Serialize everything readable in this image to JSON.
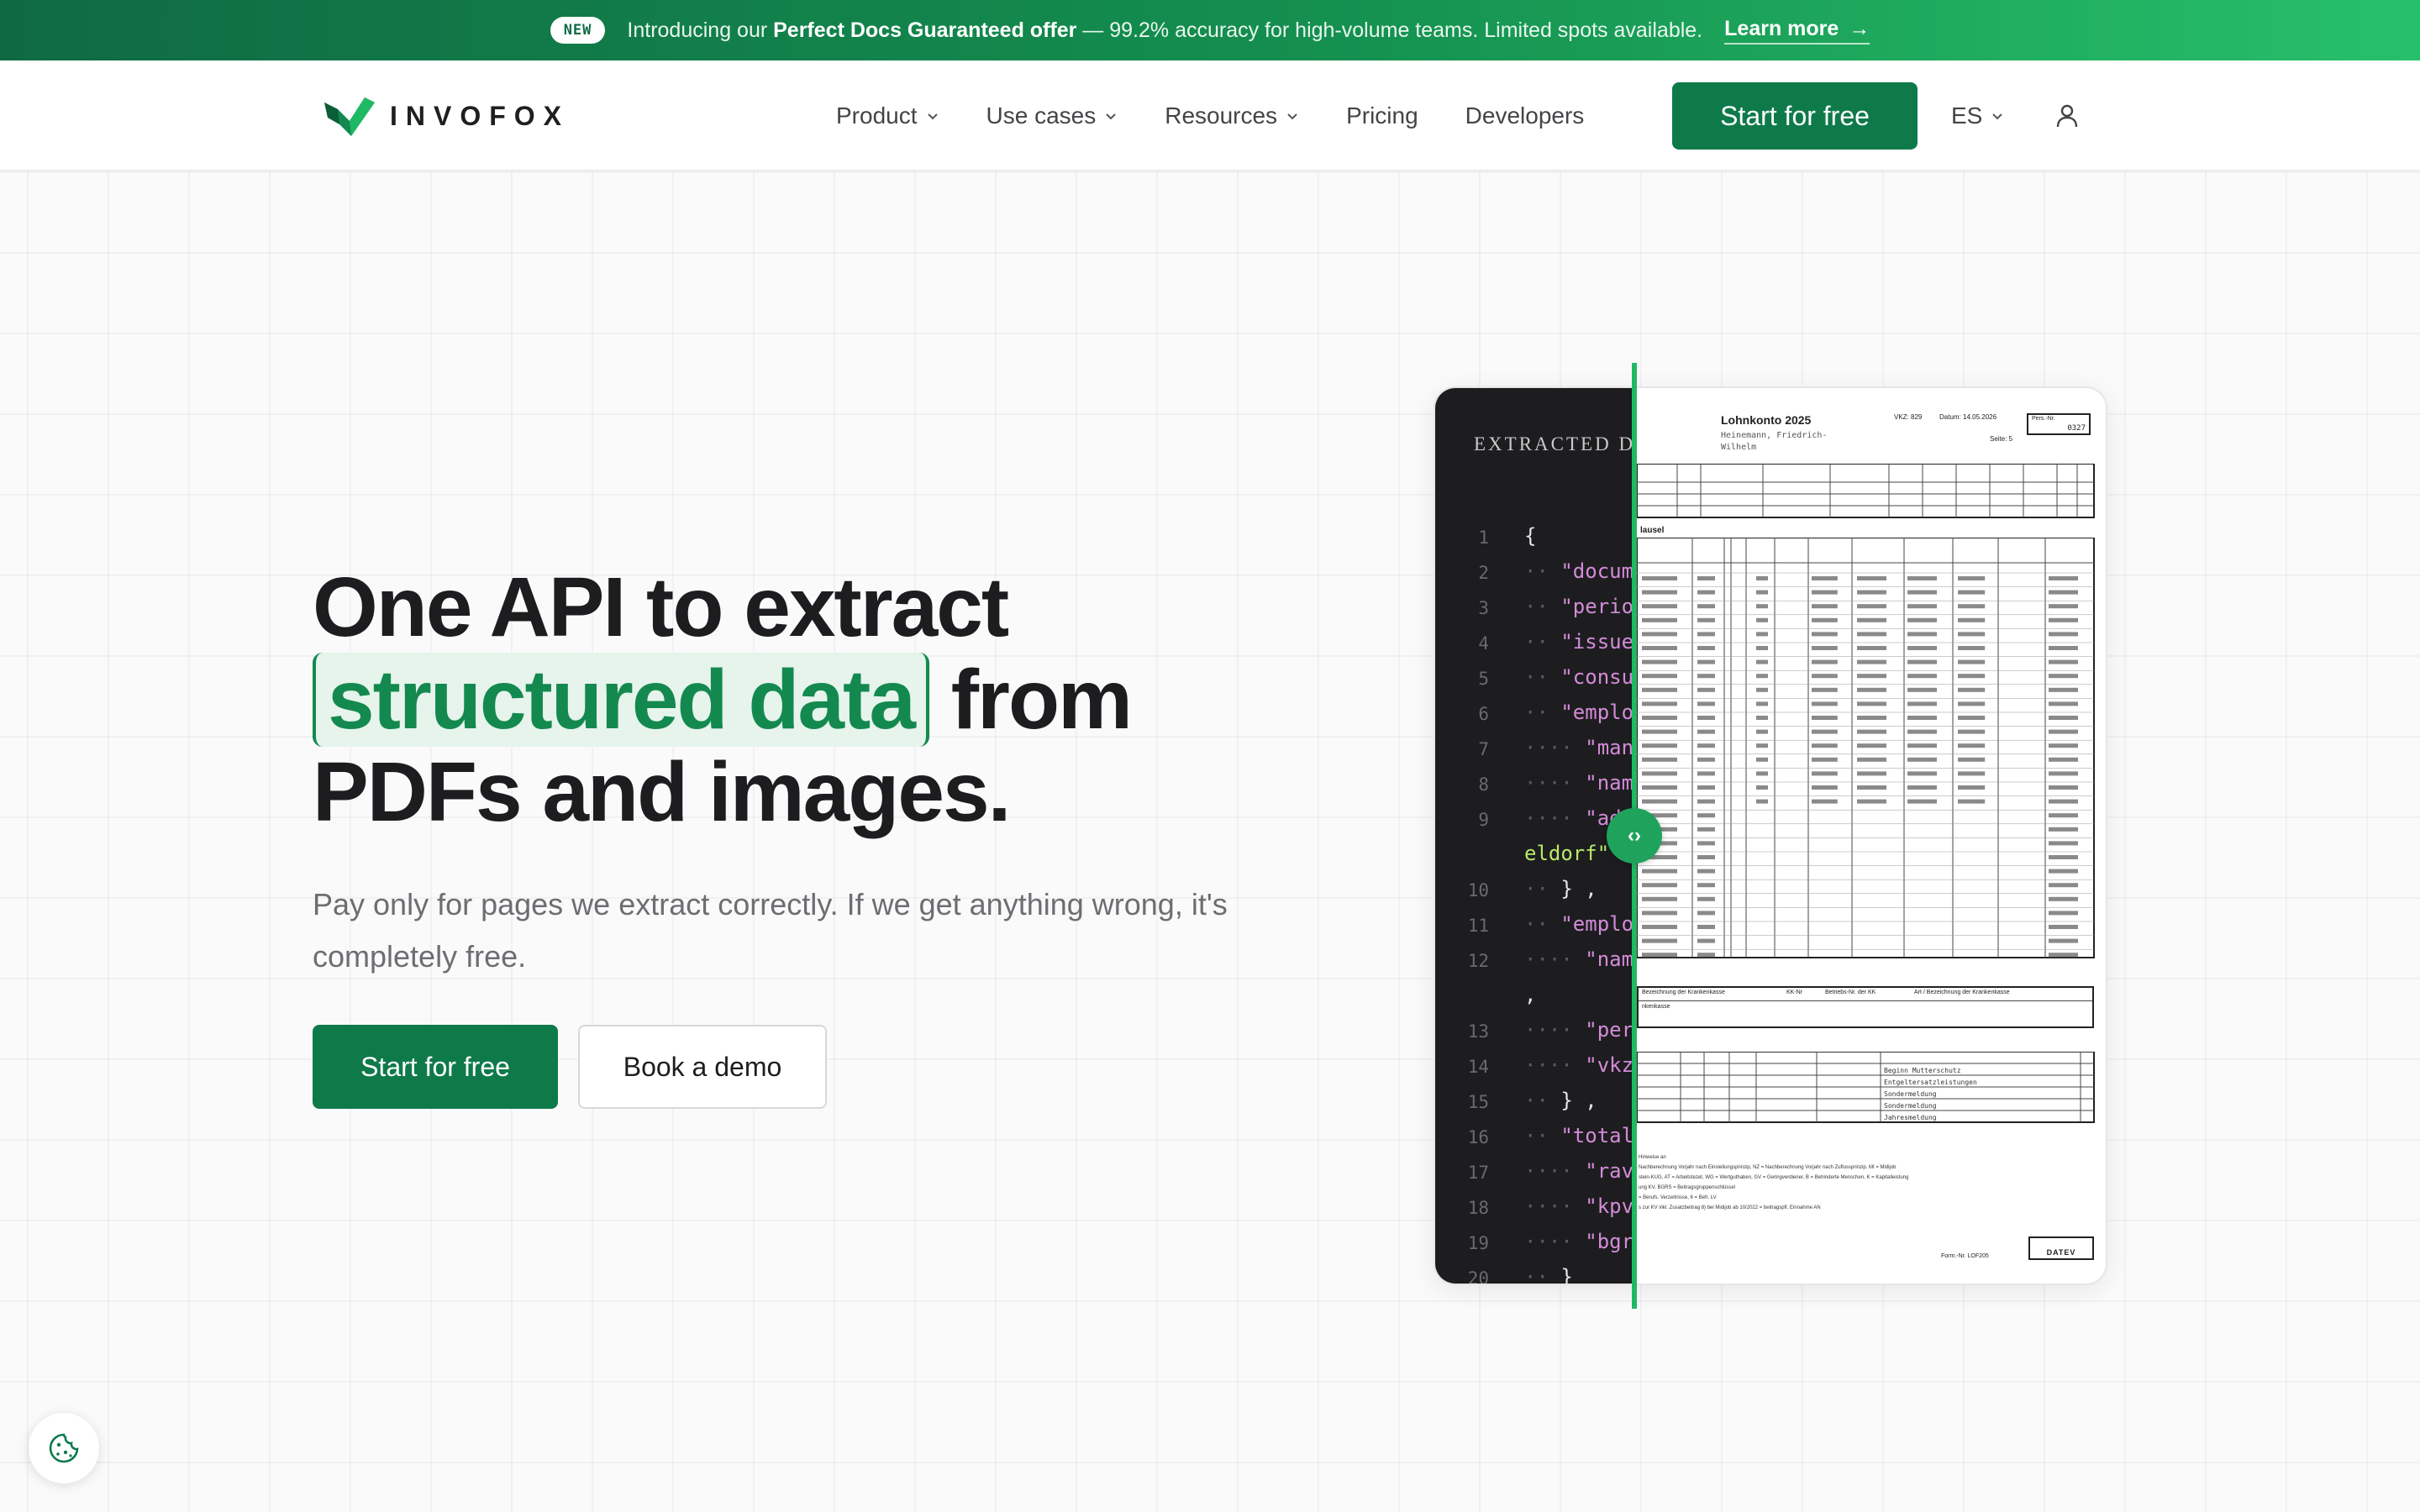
{
  "announcement": {
    "badge": "NEW",
    "prefix": "Introducing our ",
    "offer": "Perfect Docs Guaranteed offer",
    "suffix": " — 99.2% accuracy for high-volume teams. Limited spots available.",
    "link": "Learn more",
    "arrow": "→"
  },
  "brand": {
    "name": "INVOFOX",
    "color": "#14894f"
  },
  "nav": {
    "items": [
      {
        "label": "Product",
        "dropdown": true
      },
      {
        "label": "Use cases",
        "dropdown": true
      },
      {
        "label": "Resources",
        "dropdown": true
      },
      {
        "label": "Pricing",
        "dropdown": false
      },
      {
        "label": "Developers",
        "dropdown": false
      }
    ],
    "cta": "Start for free",
    "language": "ES",
    "user_icon": "user-icon"
  },
  "hero": {
    "title_line1": "One API to extract",
    "title_highlight": "structured data",
    "title_after_highlight": " from",
    "title_line3": "PDFs and images.",
    "subtitle": "Pay only for pages we extract correctly. If we get anything wrong, it's completely free.",
    "primary_button": "Start for free",
    "secondary_button": "Book a demo"
  },
  "demo": {
    "code_title": "EXTRACTED DATA",
    "lines": [
      {
        "n": "1",
        "dots": "",
        "text": "{"
      },
      {
        "n": "2",
        "dots": "··",
        "text": "\"document"
      },
      {
        "n": "3",
        "dots": "··",
        "text": "\"period"
      },
      {
        "n": "4",
        "dots": "··",
        "text": "\"issue"
      },
      {
        "n": "5",
        "dots": "··",
        "text": "\"consu"
      },
      {
        "n": "6",
        "dots": "··",
        "text": "\"emplo"
      },
      {
        "n": "7",
        "dots": "····",
        "text": "\"man"
      },
      {
        "n": "8",
        "dots": "····",
        "text": "\"nam"
      },
      {
        "n": "9",
        "dots": "····",
        "text": "\"add"
      },
      {
        "n": "",
        "dots": "",
        "text": "eldorf\""
      },
      {
        "n": "10",
        "dots": "··",
        "text": "} ,"
      },
      {
        "n": "11",
        "dots": "··",
        "text": "\"emplo"
      },
      {
        "n": "12",
        "dots": "····",
        "text": "\"nam"
      },
      {
        "n": "",
        "dots": "",
        "text": ","
      },
      {
        "n": "13",
        "dots": "····",
        "text": "\"per"
      },
      {
        "n": "14",
        "dots": "····",
        "text": "\"vkz"
      },
      {
        "n": "15",
        "dots": "··",
        "text": "} ,"
      },
      {
        "n": "16",
        "dots": "··",
        "text": "\"total"
      },
      {
        "n": "17",
        "dots": "····",
        "text": "\"rav"
      },
      {
        "n": "18",
        "dots": "····",
        "text": "\"kpv"
      },
      {
        "n": "19",
        "dots": "····",
        "text": "\"bgr"
      },
      {
        "n": "20",
        "dots": "··",
        "text": "}"
      }
    ],
    "doc": {
      "title": "Lohnkonto  2025",
      "name": "Heinemann, Friedrich-Wilhelm",
      "vkz": "VKZ: 829",
      "date": "Datum: 14.05.2026",
      "page": "Seite: 5",
      "pers_nr": "Pers.-Nr.",
      "pers_val": "0327",
      "section": "lausel",
      "form_nr": "Form.-Nr. LOF205",
      "datev": "DATEV",
      "krankenkasse": "Bezeichnung der Krankenkasse",
      "kk_nr": "KK-Nr",
      "betriebsnr": "Betriebs-Nr. der KK",
      "art": "Art / Bezeichnung der Krankenkasse",
      "kasse": "nkenkasse",
      "meldungen": [
        "Beginn Mutterschutz",
        "Entgeltersatzleistungen",
        "Sondermeldung",
        "Sondermeldung",
        "Jahresmeldung"
      ],
      "fuss": [
        "Hinweise an",
        "Nachberechnung Vorjahr nach Einstellungsprinzip, NZ = Nachberechnung Vorjahr nach Zuflussprinzip, MI = Midijob",
        "stein-KUG, AT = Arbeitstezet, WG = Wertguthaben, GV = Geringverdiener, B = Behinderte Menschen, K = Kapitalleistung",
        "ung KV, BGRS = Beitragsgruppenschlüssel",
        "= Berufs. Verzeitnisse, 6 = Befr. LV",
        "s zur KV inkl. Zusatzbeitrag  8) bei Midijob ab 10/2022 = beitragspfl. Einnahme AN"
      ]
    },
    "handle": "‹›"
  },
  "cookie_icon": "cookie-icon",
  "colors": {
    "accent": "#0e7a4a",
    "accent_light": "#1fb964",
    "highlight_bg": "#e6f4ec",
    "code_bg": "#1d1d20",
    "code_key": "#d48bd8",
    "code_string": "#b9e86a"
  }
}
